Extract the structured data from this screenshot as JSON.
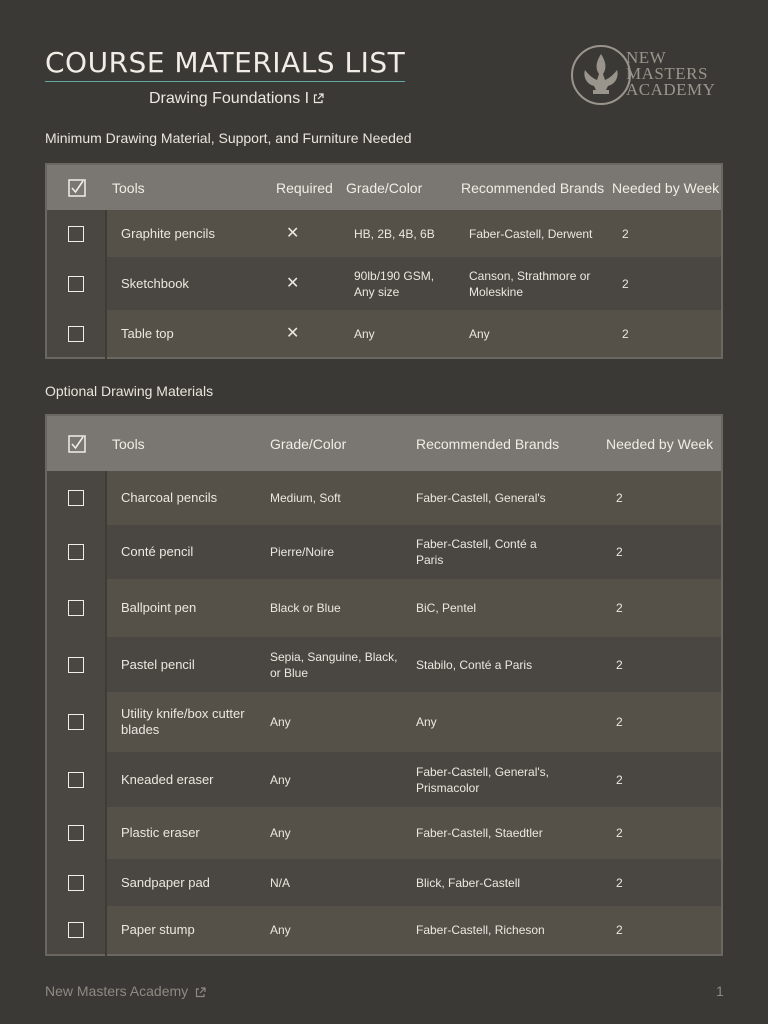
{
  "header": {
    "title": "COURSE MATERIALS LIST",
    "subtitle": "Drawing Foundations I",
    "logo_lines": [
      "NEW",
      "MASTERS",
      "ACADEMY"
    ]
  },
  "required_section": {
    "heading": "Minimum Drawing Material, Support, and Furniture Needed",
    "columns": [
      "Tools",
      "Required",
      "Grade/Color",
      "Recommended Brands",
      "Needed by Week"
    ],
    "rows": [
      {
        "tool": "Graphite pencils",
        "required": "✕",
        "grade": "HB, 2B, 4B, 6B",
        "brands": "Faber-Castell, Derwent",
        "week": "2"
      },
      {
        "tool": "Sketchbook",
        "required": "✕",
        "grade": "90lb/190 GSM, Any size",
        "brands": "Canson, Strathmore or Moleskine",
        "week": "2"
      },
      {
        "tool": "Table top",
        "required": "✕",
        "grade": "Any",
        "brands": "Any",
        "week": "2"
      }
    ]
  },
  "optional_section": {
    "heading": "Optional Drawing Materials",
    "columns": [
      "Tools",
      "Grade/Color",
      "Recommended Brands",
      "Needed by Week"
    ],
    "rows": [
      {
        "tool": "Charcoal pencils",
        "grade": "Medium, Soft",
        "brands": "Faber-Castell, General's",
        "week": "2"
      },
      {
        "tool": "Conté pencil",
        "grade": "Pierre/Noire",
        "brands": "Faber-Castell, Conté a Paris",
        "week": "2"
      },
      {
        "tool": "Ballpoint pen",
        "grade": "Black or Blue",
        "brands": "BiC, Pentel",
        "week": "2"
      },
      {
        "tool": "Pastel pencil",
        "grade": "Sepia, Sanguine, Black, or Blue",
        "brands": "Stabilo, Conté a Paris",
        "week": "2"
      },
      {
        "tool": "Utility knife/box cutter blades",
        "grade": "Any",
        "brands": "Any",
        "week": "2"
      },
      {
        "tool": "Kneaded eraser",
        "grade": "Any",
        "brands": "Faber-Castell, General's, Prismacolor",
        "week": "2"
      },
      {
        "tool": "Plastic eraser",
        "grade": "Any",
        "brands": "Faber-Castell, Staedtler",
        "week": "2"
      },
      {
        "tool": "Sandpaper pad",
        "grade": "N/A",
        "brands": "Blick, Faber-Castell",
        "week": "2"
      },
      {
        "tool": "Paper stump",
        "grade": "Any",
        "brands": "Faber-Castell, Richeson",
        "week": "2"
      }
    ]
  },
  "footer": {
    "link": "New Masters Academy",
    "page_number": "1"
  },
  "colors": {
    "background": "#3b3935",
    "header_row": "#7a7772",
    "row_light": "#555149",
    "row_dark": "#4a4743",
    "title_underline": "#5fa8a6"
  }
}
